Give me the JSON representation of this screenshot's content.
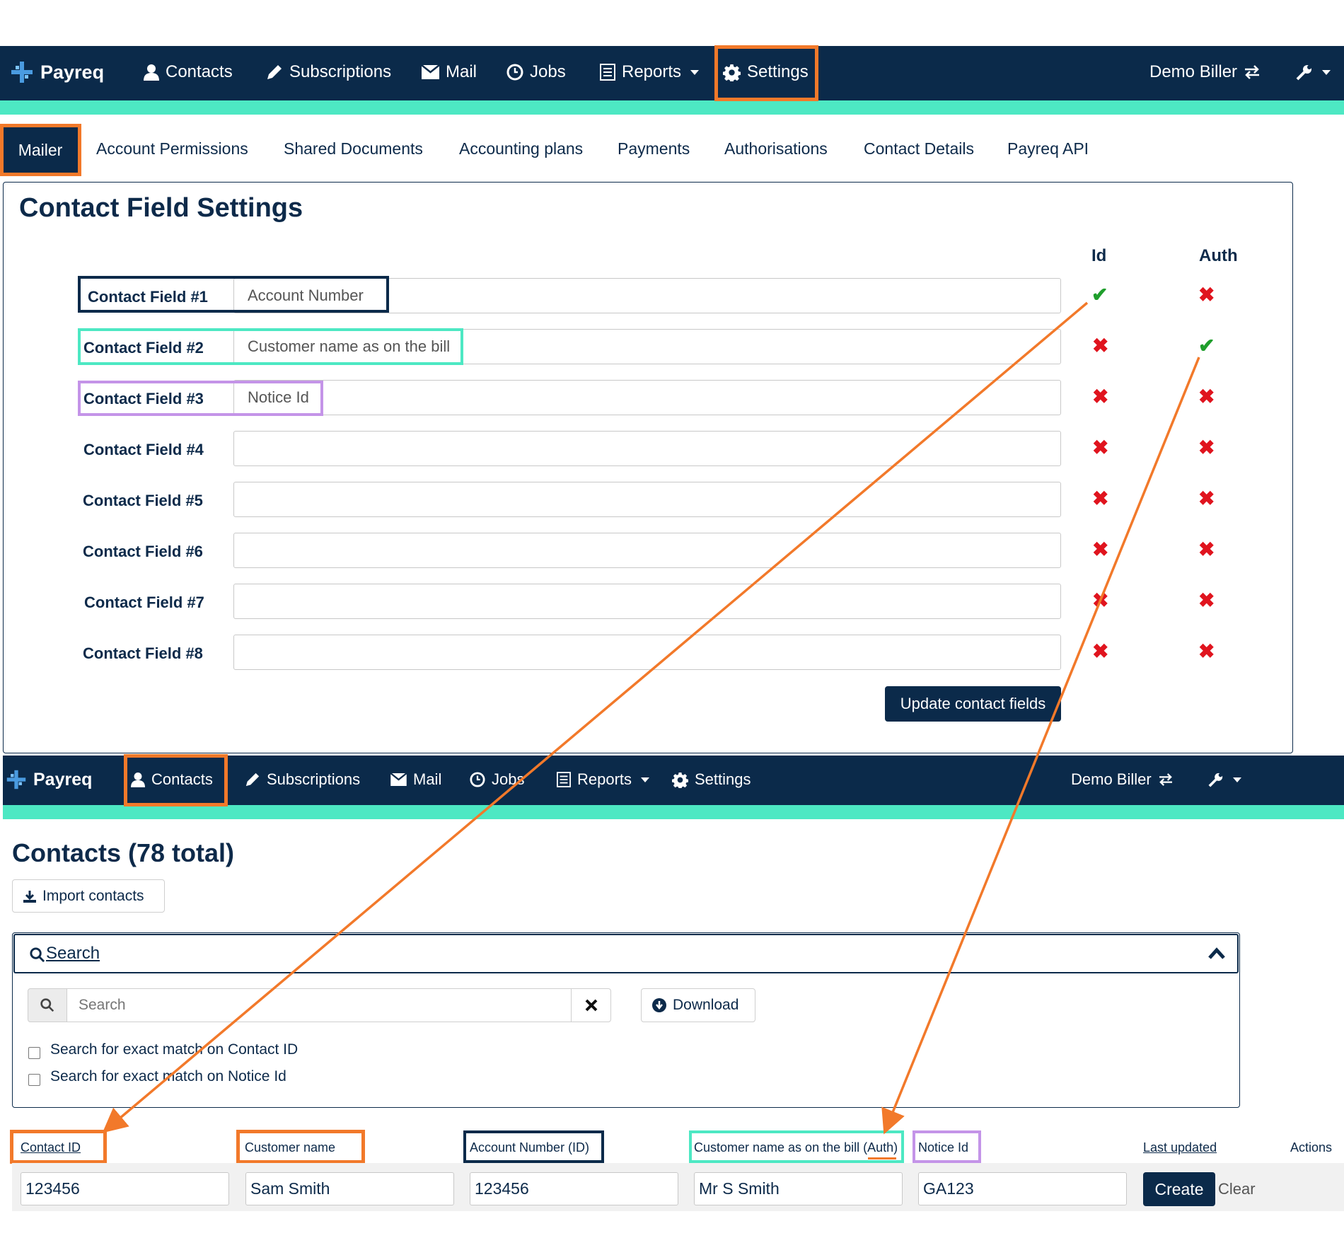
{
  "top_nav": {
    "logo": "Payreq",
    "items": [
      {
        "label": "Contacts",
        "icon": "user-icon"
      },
      {
        "label": "Subscriptions",
        "icon": "pencil-icon"
      },
      {
        "label": "Mail",
        "icon": "envelope-icon"
      },
      {
        "label": "Jobs",
        "icon": "clock-icon"
      },
      {
        "label": "Reports",
        "icon": "list-icon"
      },
      {
        "label": "Settings",
        "icon": "gear-icon"
      }
    ],
    "account": "Demo Biller",
    "highlighted": "Settings"
  },
  "settings_tabs": {
    "active": "Mailer",
    "items": [
      "Account Permissions",
      "Shared Documents",
      "Accounting plans",
      "Payments",
      "Authorisations",
      "Contact Details",
      "Payreq API"
    ]
  },
  "contact_field_settings": {
    "title": "Contact Field Settings",
    "col_id": "Id",
    "col_auth": "Auth",
    "fields": [
      {
        "label": "Contact Field #1",
        "value": "Account Number",
        "id": true,
        "auth": false
      },
      {
        "label": "Contact Field #2",
        "value": "Customer name as on the bill",
        "id": false,
        "auth": true
      },
      {
        "label": "Contact Field #3",
        "value": "Notice Id",
        "id": false,
        "auth": false
      },
      {
        "label": "Contact Field #4",
        "value": "",
        "id": false,
        "auth": false
      },
      {
        "label": "Contact Field #5",
        "value": "",
        "id": false,
        "auth": false
      },
      {
        "label": "Contact Field #6",
        "value": "",
        "id": false,
        "auth": false
      },
      {
        "label": "Contact Field #7",
        "value": "",
        "id": false,
        "auth": false
      },
      {
        "label": "Contact Field #8",
        "value": "",
        "id": false,
        "auth": false
      }
    ],
    "check_glyph": "✔",
    "cross_glyph": "✖",
    "update_button": "Update contact fields"
  },
  "bottom_nav": {
    "logo": "Payreq",
    "items": [
      "Contacts",
      "Subscriptions",
      "Mail",
      "Jobs",
      "Reports",
      "Settings"
    ],
    "account": "Demo Biller",
    "highlighted": "Contacts"
  },
  "contacts_page": {
    "title": "Contacts (78 total)",
    "import_button": "Import contacts",
    "search_header": "Search",
    "search_placeholder": "Search",
    "download_button": "Download",
    "checkboxes": [
      "Search for exact match on Contact ID",
      "Search for exact match on Notice Id"
    ],
    "columns": [
      "Contact ID",
      "Customer name",
      "Account Number (ID)",
      "Customer name as on the bill (Auth)",
      "Notice Id",
      "Last updated",
      "Actions"
    ],
    "new_row": [
      "123456",
      "Sam Smith",
      "123456",
      "Mr S Smith",
      "GA123"
    ],
    "create_button": "Create",
    "clear_link": "Clear"
  },
  "colors": {
    "navy": "#0b2a4a",
    "teal": "#4de8c3",
    "orange": "#f2792a",
    "purple": "#c494e8",
    "check_green": "#1f9e2c",
    "cross_red": "#e0141e"
  }
}
